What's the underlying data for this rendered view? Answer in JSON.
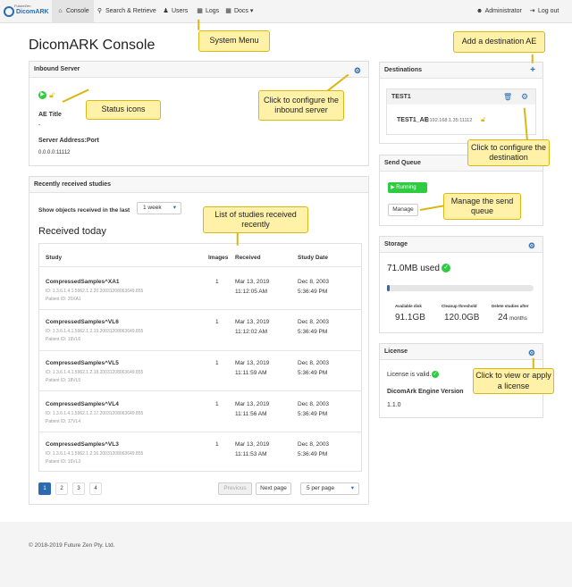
{
  "navbar": {
    "logo_small": "FutureZen",
    "logo_main": "DicomARK",
    "items": [
      {
        "label": "Console",
        "icon": "home-icon"
      },
      {
        "label": "Search & Retrieve",
        "icon": "search-icon"
      },
      {
        "label": "Users",
        "icon": "users-icon"
      },
      {
        "label": "Logs",
        "icon": "file-icon"
      },
      {
        "label": "Docs",
        "icon": "book-icon"
      }
    ],
    "user": "Administrator",
    "logout": "Log out"
  },
  "page_title": "DicomARK Console",
  "inbound": {
    "title": "Inbound Server",
    "ae_title_label": "AE Title",
    "ae_title_value": "-",
    "address_label": "Server Address:Port",
    "address_value": "0.0.0.0:11112"
  },
  "recent": {
    "title": "Recently received studies",
    "filter_label": "Show objects received in the last",
    "filter_value": "1 week",
    "subtitle": "Received today",
    "columns": [
      "Study",
      "Images",
      "Received",
      "Study Date"
    ],
    "rows": [
      {
        "name": "CompressedSamples^XA1",
        "id": "ID: 1.3.6.1.4.1.5962.1.2.20.20031208063649.855",
        "patient": "Patient ID: 20XA1",
        "images": "1",
        "rdate": "Mar 13, 2019",
        "rtime": "11:12:05 AM",
        "sdate": "Dec 8, 2003",
        "stime": "5:36:49 PM"
      },
      {
        "name": "CompressedSamples^VL6",
        "id": "ID: 1.3.6.1.4.1.5962.1.2.19.20031208063649.855",
        "patient": "Patient ID: 19VL6",
        "images": "1",
        "rdate": "Mar 13, 2019",
        "rtime": "11:12:02 AM",
        "sdate": "Dec 8, 2003",
        "stime": "5:36:49 PM"
      },
      {
        "name": "CompressedSamples^VL5",
        "id": "ID: 1.3.6.1.4.1.5962.1.2.18.20031208063649.855",
        "patient": "Patient ID: 18VL5",
        "images": "1",
        "rdate": "Mar 13, 2019",
        "rtime": "11:11:59 AM",
        "sdate": "Dec 8, 2003",
        "stime": "5:36:49 PM"
      },
      {
        "name": "CompressedSamples^VL4",
        "id": "ID: 1.3.6.1.4.1.5962.1.2.17.20031208063649.855",
        "patient": "Patient ID: 17VL4",
        "images": "1",
        "rdate": "Mar 13, 2019",
        "rtime": "11:11:56 AM",
        "sdate": "Dec 8, 2003",
        "stime": "5:36:49 PM"
      },
      {
        "name": "CompressedSamples^VL3",
        "id": "ID: 1.3.6.1.4.1.5962.1.2.16.20031208063649.855",
        "patient": "Patient ID: 16VL3",
        "images": "1",
        "rdate": "Mar 13, 2019",
        "rtime": "11:11:53 AM",
        "sdate": "Dec 8, 2003",
        "stime": "5:36:49 PM"
      }
    ],
    "pages": [
      "1",
      "2",
      "3",
      "4"
    ],
    "previous": "Previous",
    "next": "Next page",
    "per_page": "5 per page"
  },
  "destinations": {
    "title": "Destinations",
    "name": "TEST1",
    "ae": "TEST1_AE",
    "address": "@192.168.1.35:11112"
  },
  "send_queue": {
    "title": "Send Queue",
    "status": "Running",
    "manage": "Manage"
  },
  "storage": {
    "title": "Storage",
    "used": "71.0MB used",
    "used_fraction": 0.02,
    "available_label": "Available disk",
    "available_value": "91.1GB",
    "threshold_label": "Cleanup threshold",
    "threshold_value": "120.0GB",
    "delete_label": "Delete studies after",
    "delete_value": "24",
    "delete_unit": "months"
  },
  "license": {
    "title": "License",
    "status": "License is valid.",
    "engine_label": "DicomArk Engine Version",
    "engine_value": "1.1.0"
  },
  "callouts": {
    "system_menu": "System Menu",
    "add_destination": "Add a destination AE",
    "status_icons": "Status icons",
    "configure_inbound": "Click to configure the inbound server",
    "configure_destination": "Click to configure the destination",
    "list_studies": "List of studies received recently",
    "manage_queue": "Manage the send queue",
    "view_license": "Click to view or apply a license"
  },
  "footer": "© 2018-2019 Future Zen Pty. Ltd.",
  "colors": {
    "accent": "#2b6cb0",
    "success": "#2ecc40",
    "callout": "#fff2a8"
  }
}
